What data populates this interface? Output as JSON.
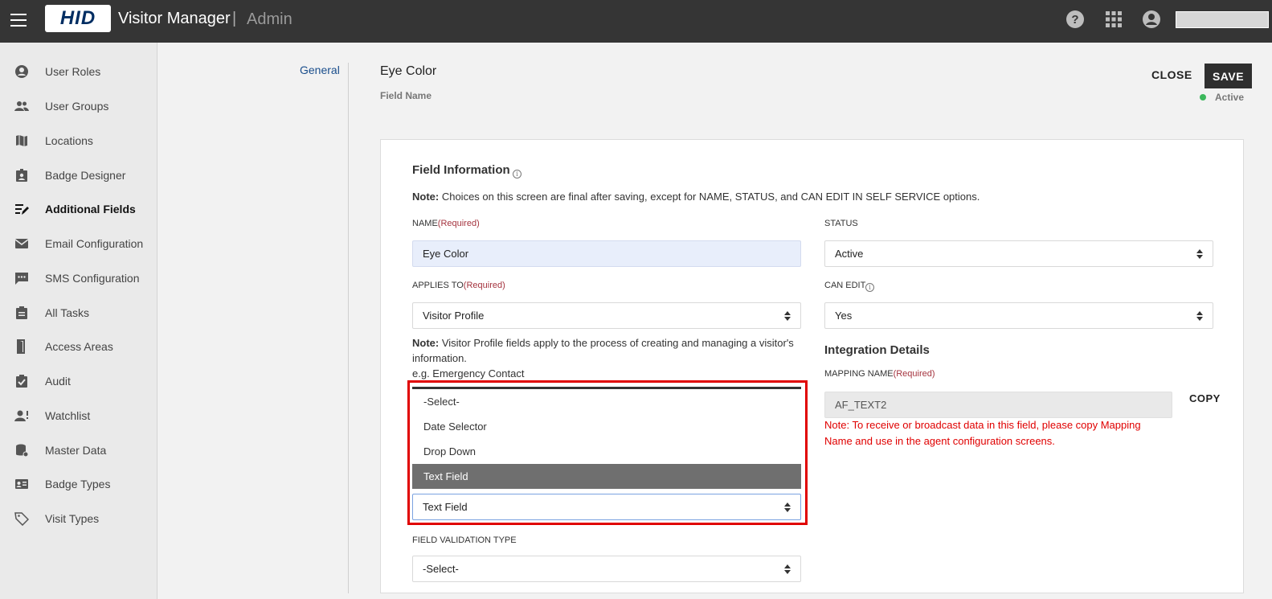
{
  "header": {
    "logo": "HID",
    "app_title": "Visitor Manager",
    "separator": "|",
    "section": "Admin",
    "icons": [
      "help-icon",
      "apps-grid-icon",
      "account-icon"
    ]
  },
  "sidebar": {
    "items": [
      {
        "label": "User Roles",
        "icon": "user-circle-icon"
      },
      {
        "label": "User Groups",
        "icon": "users-icon"
      },
      {
        "label": "Locations",
        "icon": "map-icon"
      },
      {
        "label": "Badge Designer",
        "icon": "badge-icon"
      },
      {
        "label": "Additional Fields",
        "icon": "edit-list-icon",
        "active": true
      },
      {
        "label": "Email Configuration",
        "icon": "mail-icon"
      },
      {
        "label": "SMS Configuration",
        "icon": "chat-icon"
      },
      {
        "label": "All Tasks",
        "icon": "clipboard-icon"
      },
      {
        "label": "Access Areas",
        "icon": "door-icon"
      },
      {
        "label": "Audit",
        "icon": "check-clipboard-icon"
      },
      {
        "label": "Watchlist",
        "icon": "user-alert-icon"
      },
      {
        "label": "Master Data",
        "icon": "database-icon"
      },
      {
        "label": "Badge Types",
        "icon": "id-card-icon"
      },
      {
        "label": "Visit Types",
        "icon": "tag-icon"
      }
    ]
  },
  "tabs": {
    "general": "General"
  },
  "page": {
    "title": "Eye Color",
    "subtitle": "Field Name",
    "close_label": "CLOSE",
    "save_label": "SAVE",
    "status": "Active",
    "status_color": "#3cb85c"
  },
  "form": {
    "section_title": "Field Information",
    "note_bold": "Note:",
    "note_text": " Choices on this screen are final after saving, except for NAME, STATUS, and CAN EDIT IN SELF SERVICE options.",
    "name_label": "NAME",
    "required": "(Required)",
    "name_value": "Eye Color",
    "status_label": "STATUS",
    "status_value": "Active",
    "applies_label": "APPLIES TO",
    "applies_value": "Visitor Profile",
    "can_edit_label": "CAN EDIT",
    "can_edit_value": "Yes",
    "applies_note_bold": "Note:",
    "applies_note_text": " Visitor Profile fields apply to the process of creating and managing a visitor's information.",
    "applies_note_example": "e.g. Emergency Contact",
    "field_type_options": [
      "-Select-",
      "Date Selector",
      "Drop Down",
      "Text Field"
    ],
    "field_type_selected": "Text Field",
    "validation_label": "FIELD VALIDATION TYPE",
    "validation_value": "-Select-"
  },
  "integration": {
    "title": "Integration Details",
    "mapping_label": "MAPPING NAME",
    "required": "(Required)",
    "mapping_value": "AF_TEXT2",
    "copy_label": "COPY",
    "note": "Note: To receive or broadcast data in this field, please copy Mapping Name and use in the agent configuration screens."
  }
}
